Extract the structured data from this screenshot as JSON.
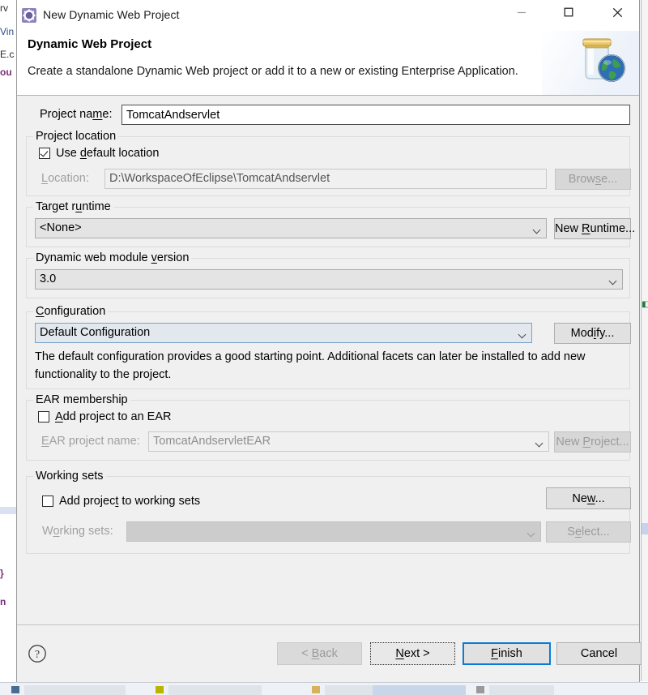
{
  "window": {
    "title": "New Dynamic Web Project",
    "app_icon": "eclipse-wizard-gear-icon",
    "minimize_label": "Minimize",
    "maximize_label": "Maximize",
    "close_label": "Close"
  },
  "header": {
    "title": "Dynamic Web Project",
    "description": "Create a standalone Dynamic Web project or add it to a new or existing Enterprise Application.",
    "banner_icon": "jar-with-globe-icon"
  },
  "project_name": {
    "label_before": "Project na",
    "label_mnemonic": "m",
    "label_after": "e:",
    "value": "TomcatAndservlet",
    "placeholder": ""
  },
  "project_location": {
    "group_label": "Project location",
    "use_default": {
      "before": "Use ",
      "mnemonic": "d",
      "after": "efault location",
      "checked": true
    },
    "location_label": {
      "mnemonic": "L",
      "after": "ocation:"
    },
    "location_value": "D:\\WorkspaceOfEclipse\\TomcatAndservlet",
    "browse": {
      "before": "Brow",
      "mnemonic": "s",
      "after": "e...",
      "enabled": false
    }
  },
  "target_runtime": {
    "group_label_before": "Target r",
    "group_label_mnemonic": "u",
    "group_label_after": "ntime",
    "selected": "<None>",
    "new_runtime": {
      "before": "New ",
      "mnemonic": "R",
      "after": "untime...",
      "enabled": true
    }
  },
  "module_version": {
    "group_label_before": "Dynamic web module ",
    "group_label_mnemonic": "v",
    "group_label_after": "ersion",
    "selected": "3.0"
  },
  "configuration": {
    "group_label_mnemonic": "C",
    "group_label_after": "onfiguration",
    "selected": "Default Configuration",
    "focused": true,
    "modify": {
      "before": "Mod",
      "mnemonic": "i",
      "after": "fy...",
      "enabled": true
    },
    "description": "The default configuration provides a good starting point. Additional facets can later be installed to add new functionality to the project."
  },
  "ear_membership": {
    "group_label": "EAR membership",
    "add_to_ear": {
      "mnemonic": "A",
      "after": "dd project to an EAR",
      "checked": false
    },
    "ear_name_label": {
      "mnemonic": "E",
      "after": "AR project name:"
    },
    "ear_name_value": "TomcatAndservletEAR",
    "new_project": {
      "before": "New ",
      "mnemonic": "P",
      "after": "roject...",
      "enabled": false
    }
  },
  "working_sets": {
    "group_label": "Working sets",
    "add_to_working_sets": {
      "before": "Add projec",
      "mnemonic": "t",
      "after": " to working sets",
      "checked": false
    },
    "working_sets_label": {
      "before": "W",
      "mnemonic": "o",
      "after": "rking sets:"
    },
    "working_sets_value": "",
    "new_button": {
      "before": "Ne",
      "mnemonic": "w",
      "after": "...",
      "enabled": true
    },
    "select_button": {
      "before": "S",
      "mnemonic": "e",
      "after": "lect...",
      "enabled": false
    }
  },
  "buttons": {
    "help_icon": "help-question-icon",
    "back": {
      "before": "< ",
      "mnemonic": "B",
      "after": "ack",
      "enabled": false
    },
    "next": {
      "before": "",
      "mnemonic": "N",
      "after": "ext >",
      "enabled": true,
      "focused": true
    },
    "finish": {
      "before": "",
      "mnemonic": "F",
      "after": "inish",
      "enabled": true,
      "default": true
    },
    "cancel": {
      "label": "Cancel",
      "enabled": true
    }
  },
  "colors": {
    "dialog_bg": "#f0f0f0",
    "default_button_border": "#0a7bd6",
    "focus_combo_border": "#7aa2c8",
    "disabled_text": "#9b9b9b"
  }
}
